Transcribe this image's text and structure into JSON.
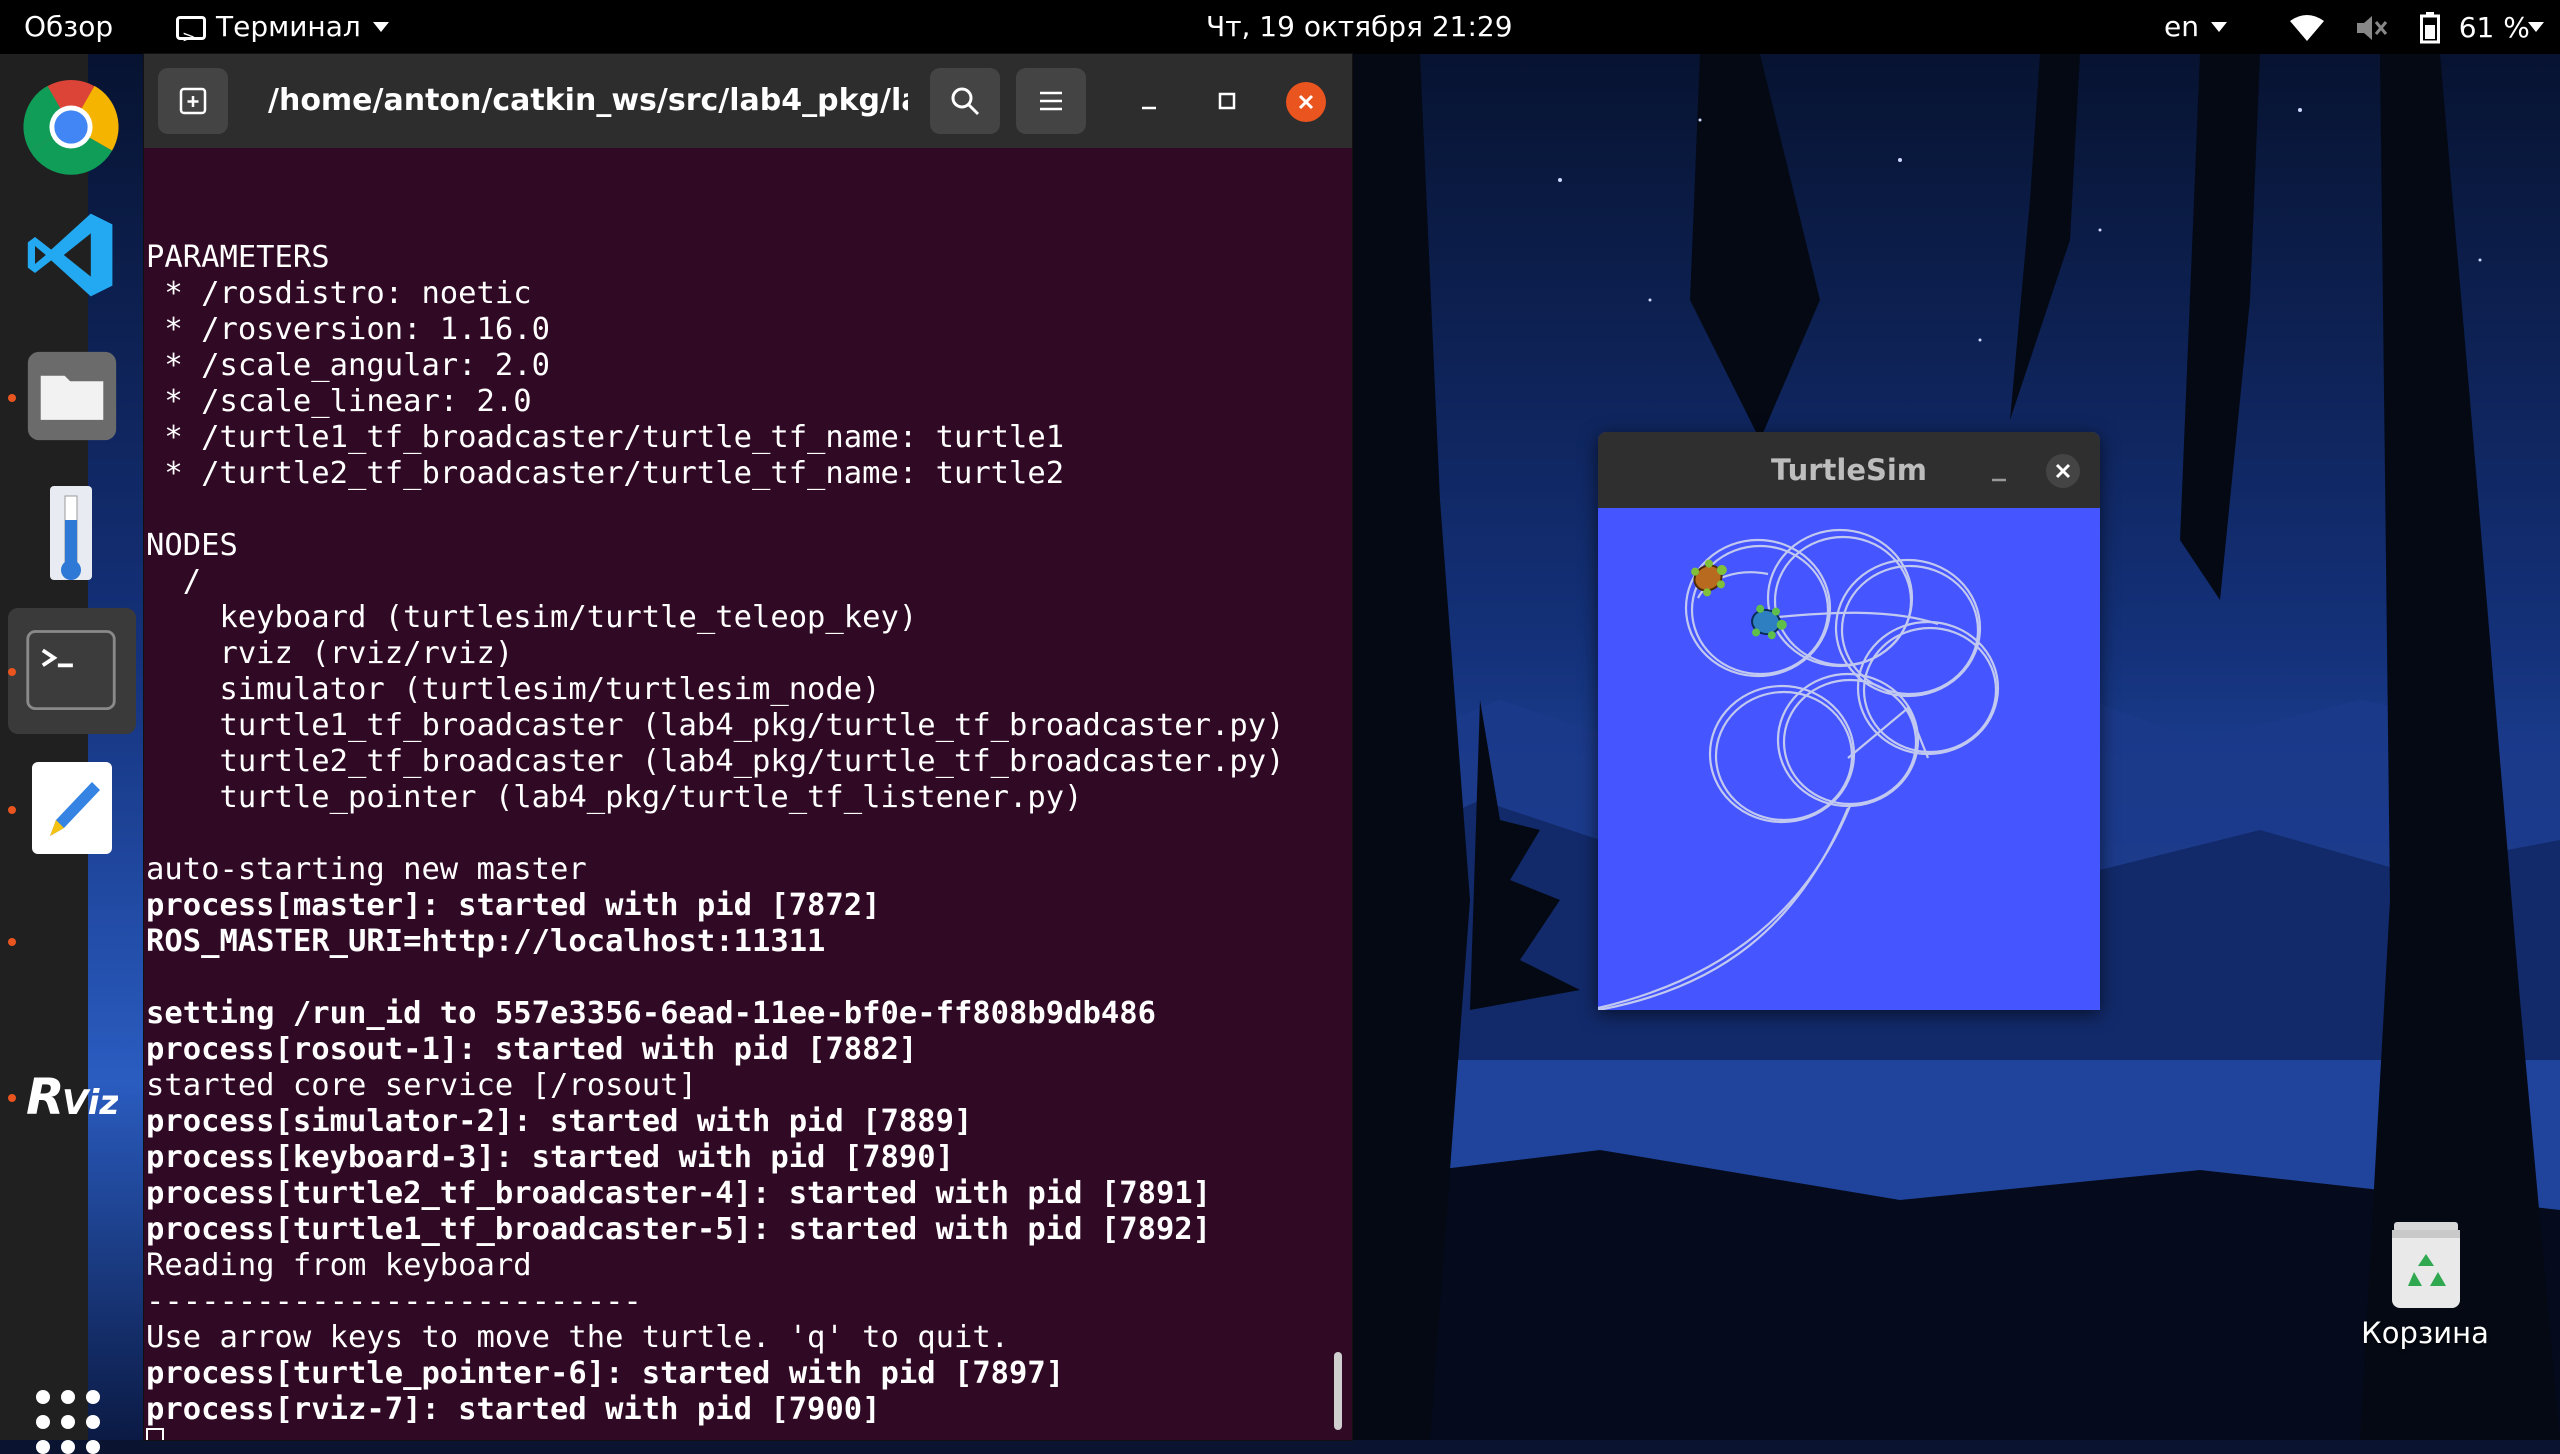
{
  "topbar": {
    "activities": "Обзор",
    "app_name": "Терминал",
    "clock": "Чт, 19 октября  21:29",
    "language": "en",
    "battery": "61 %"
  },
  "dock": {
    "items": [
      {
        "icon": "chrome-icon"
      },
      {
        "icon": "vscode-icon"
      },
      {
        "icon": "files-icon"
      },
      {
        "icon": "thermometer-icon"
      },
      {
        "icon": "terminal-icon"
      },
      {
        "icon": "text-editor-icon"
      },
      {
        "icon": "rviz-icon",
        "label": "RViz"
      }
    ]
  },
  "terminal": {
    "title": "/home/anton/catkin_ws/src/lab4_pkg/lau...",
    "lines": [
      {
        "text": "PARAMETERS",
        "bold": false
      },
      {
        "text": " * /rosdistro: noetic",
        "bold": false
      },
      {
        "text": " * /rosversion: 1.16.0",
        "bold": false
      },
      {
        "text": " * /scale_angular: 2.0",
        "bold": false
      },
      {
        "text": " * /scale_linear: 2.0",
        "bold": false
      },
      {
        "text": " * /turtle1_tf_broadcaster/turtle_tf_name: turtle1",
        "bold": false
      },
      {
        "text": " * /turtle2_tf_broadcaster/turtle_tf_name: turtle2",
        "bold": false
      },
      {
        "text": "",
        "bold": false
      },
      {
        "text": "NODES",
        "bold": false
      },
      {
        "text": "  /",
        "bold": false
      },
      {
        "text": "    keyboard (turtlesim/turtle_teleop_key)",
        "bold": false
      },
      {
        "text": "    rviz (rviz/rviz)",
        "bold": false
      },
      {
        "text": "    simulator (turtlesim/turtlesim_node)",
        "bold": false
      },
      {
        "text": "    turtle1_tf_broadcaster (lab4_pkg/turtle_tf_broadcaster.py)",
        "bold": false
      },
      {
        "text": "    turtle2_tf_broadcaster (lab4_pkg/turtle_tf_broadcaster.py)",
        "bold": false
      },
      {
        "text": "    turtle_pointer (lab4_pkg/turtle_tf_listener.py)",
        "bold": false
      },
      {
        "text": "",
        "bold": false
      },
      {
        "text": "auto-starting new master",
        "bold": false
      },
      {
        "text": "process[master]: started with pid [7872]",
        "bold": true
      },
      {
        "text": "ROS_MASTER_URI=http://localhost:11311",
        "bold": true
      },
      {
        "text": "",
        "bold": false
      },
      {
        "text": "setting /run_id to 557e3356-6ead-11ee-bf0e-ff808b9db486",
        "bold": true
      },
      {
        "text": "process[rosout-1]: started with pid [7882]",
        "bold": true
      },
      {
        "text": "started core service [/rosout]",
        "bold": false
      },
      {
        "text": "process[simulator-2]: started with pid [7889]",
        "bold": true
      },
      {
        "text": "process[keyboard-3]: started with pid [7890]",
        "bold": true
      },
      {
        "text": "process[turtle2_tf_broadcaster-4]: started with pid [7891]",
        "bold": true
      },
      {
        "text": "process[turtle1_tf_broadcaster-5]: started with pid [7892]",
        "bold": true
      },
      {
        "text": "Reading from keyboard",
        "bold": false
      },
      {
        "text": "---------------------------",
        "bold": false
      },
      {
        "text": "Use arrow keys to move the turtle. 'q' to quit.",
        "bold": false
      },
      {
        "text": "process[turtle_pointer-6]: started with pid [7897]",
        "bold": true
      },
      {
        "text": "process[rviz-7]: started with pid [7900]",
        "bold": true
      }
    ]
  },
  "turtlesim": {
    "title": "TurtleSim",
    "background_color": "#4555ff"
  },
  "desktop": {
    "trash_label": "Корзина"
  }
}
